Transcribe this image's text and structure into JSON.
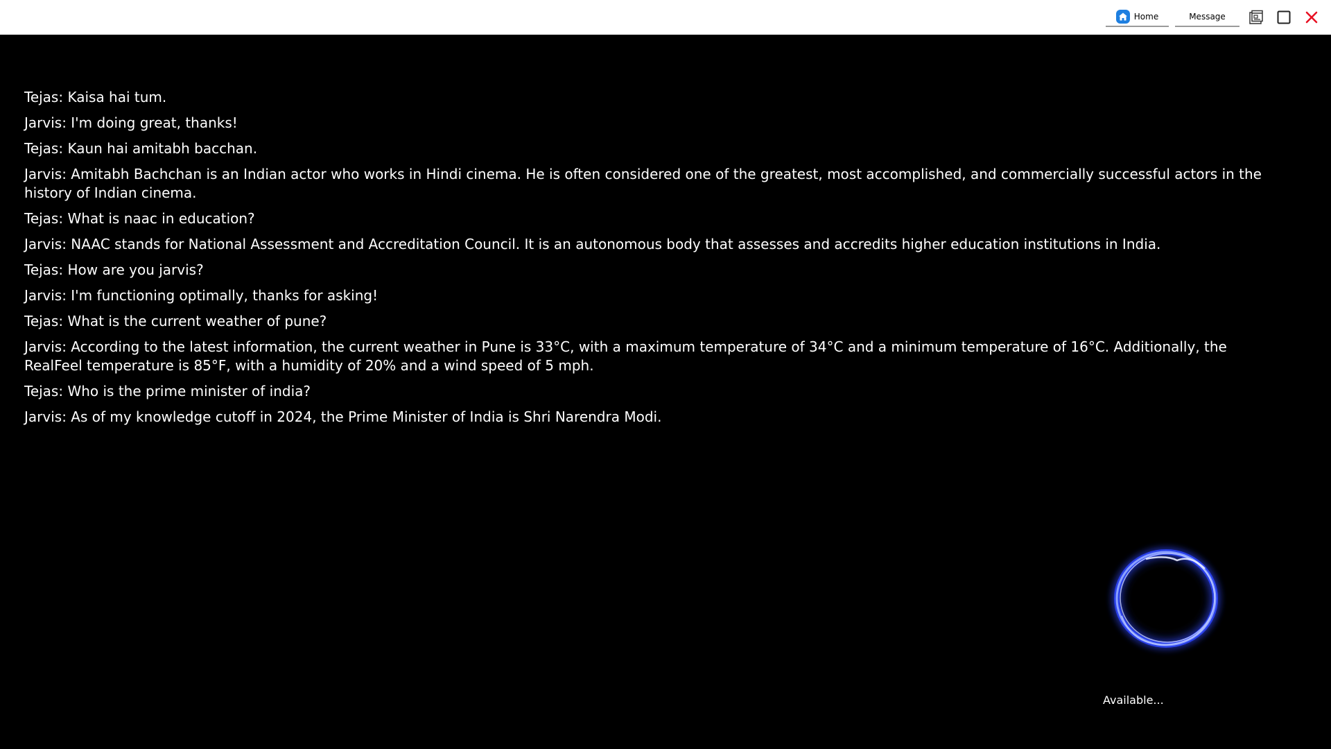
{
  "topbar": {
    "home_label": "Home",
    "message_label": "Message"
  },
  "icons": {
    "home": "home-icon",
    "restore": "restore-window-icon",
    "maximize": "maximize-icon",
    "close": "close-icon"
  },
  "colors": {
    "background": "#000000",
    "topbar": "#ffffff",
    "accent_home": "#1e7fe0",
    "close_red": "#e81123",
    "orb_glow": "#4a6bff"
  },
  "chat": {
    "messages": [
      "Tejas: Kaisa hai tum.",
      "Jarvis: I'm doing great, thanks!",
      "Tejas: Kaun hai amitabh bacchan.",
      "Jarvis: Amitabh Bachchan is an Indian actor who works in Hindi cinema. He is often considered one of the greatest, most accomplished, and commercially successful actors in the history of Indian cinema.",
      "Tejas: What is naac in education?",
      "Jarvis: NAAC stands for National Assessment and Accreditation Council. It is an autonomous body that assesses and accredits higher education institutions in India.",
      "Tejas: How are you jarvis?",
      "Jarvis: I'm functioning optimally, thanks for asking!",
      "Tejas: What is the current weather of pune?",
      "Jarvis: According to the latest information, the current weather in Pune is 33°C, with a maximum temperature of 34°C and a minimum temperature of 16°C. Additionally, the RealFeel temperature is 85°F, with a humidity of 20% and a wind speed of 5 mph.",
      "Tejas: Who is the prime minister of india?",
      "Jarvis: As of my knowledge cutoff in 2024, the Prime Minister of India is Shri Narendra Modi."
    ]
  },
  "assistant": {
    "status_text": "Available..."
  }
}
